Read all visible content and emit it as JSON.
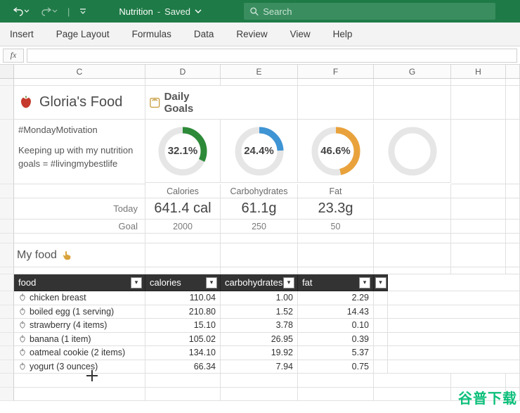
{
  "app": {
    "doc_name": "Nutrition",
    "save_state": "Saved",
    "search_placeholder": "Search"
  },
  "ribbon": [
    "Insert",
    "Page Layout",
    "Formulas",
    "Data",
    "Review",
    "View",
    "Help"
  ],
  "columns": [
    "C",
    "D",
    "E",
    "F",
    "G",
    "H"
  ],
  "titles": {
    "main": "Gloria's Food",
    "goals": "Daily Goals"
  },
  "note_line1": "#MondayMotivation",
  "note_line2": "Keeping up with my nutrition goals = #livingmybestlife",
  "gauges": {
    "calories": {
      "pct_label": "32.1%",
      "pct": 32.1,
      "color": "#2d8a38"
    },
    "carbs": {
      "pct_label": "24.4%",
      "pct": 24.4,
      "color": "#3f94d4"
    },
    "fat": {
      "pct_label": "46.6%",
      "pct": 46.6,
      "color": "#e9a23b"
    },
    "extra": {
      "pct_label": "",
      "pct": 0,
      "color": "#dcdcdc"
    }
  },
  "labels": {
    "calories": "Calories",
    "carbs": "Carbohydrates",
    "fat": "Fat",
    "today": "Today",
    "goal": "Goal"
  },
  "today": {
    "calories": "641.4 cal",
    "carbs": "61.1g",
    "fat": "23.3g"
  },
  "goal": {
    "calories": "2000",
    "carbs": "250",
    "fat": "50"
  },
  "section_myfood": "My food",
  "table": {
    "headers": {
      "food": "food",
      "calories": "calories",
      "carbs": "carbohydrates",
      "fat": "fat"
    },
    "rows": [
      {
        "name": "chicken breast",
        "calories": "110.04",
        "carbs": "1.00",
        "fat": "2.29"
      },
      {
        "name": "boiled egg (1 serving)",
        "calories": "210.80",
        "carbs": "1.52",
        "fat": "14.43"
      },
      {
        "name": "strawberry (4 items)",
        "calories": "15.10",
        "carbs": "3.78",
        "fat": "0.10"
      },
      {
        "name": "banana (1 item)",
        "calories": "105.02",
        "carbs": "26.95",
        "fat": "0.39"
      },
      {
        "name": "oatmeal cookie (2 items)",
        "calories": "134.10",
        "carbs": "19.92",
        "fat": "5.37"
      },
      {
        "name": "yogurt (3 ounces)",
        "calories": "66.34",
        "carbs": "7.94",
        "fat": "0.75"
      }
    ]
  },
  "watermark": "谷普下载"
}
